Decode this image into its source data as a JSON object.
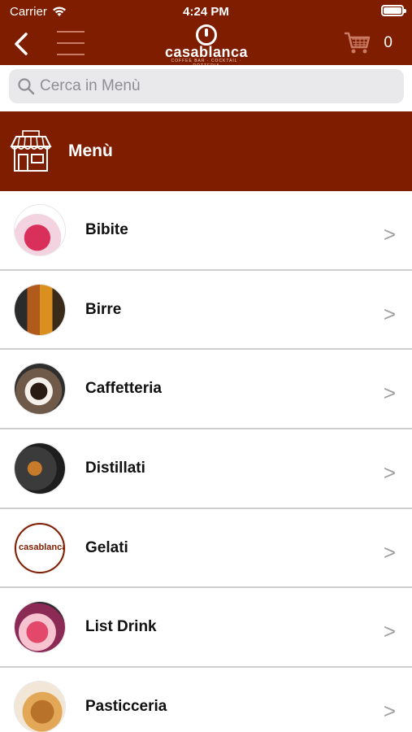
{
  "status_bar": {
    "carrier": "Carrier",
    "time": "4:24 PM"
  },
  "nav": {
    "logo_text": "casablanca",
    "logo_tagline": "COFFEE BAR · COCKTAIL · ROTTERIA",
    "cart_count": "0"
  },
  "search": {
    "placeholder": "Cerca in Menù"
  },
  "banner": {
    "title": "Menù",
    "icon": "shop-icon"
  },
  "menu_items": [
    {
      "label": "Bibite",
      "chevron": ">"
    },
    {
      "label": "Birre",
      "chevron": ">"
    },
    {
      "label": "Caffetteria",
      "chevron": ">"
    },
    {
      "label": "Distillati",
      "chevron": ">"
    },
    {
      "label": "Gelati",
      "chevron": ">"
    },
    {
      "label": "List Drink",
      "chevron": ">"
    },
    {
      "label": "Pasticceria",
      "chevron": ">"
    }
  ],
  "gelati_thumb_text": "casablanca",
  "colors": {
    "brand": "#7f1d00",
    "search_bg": "#e9e9eb",
    "chevron": "#a0a0a0"
  }
}
